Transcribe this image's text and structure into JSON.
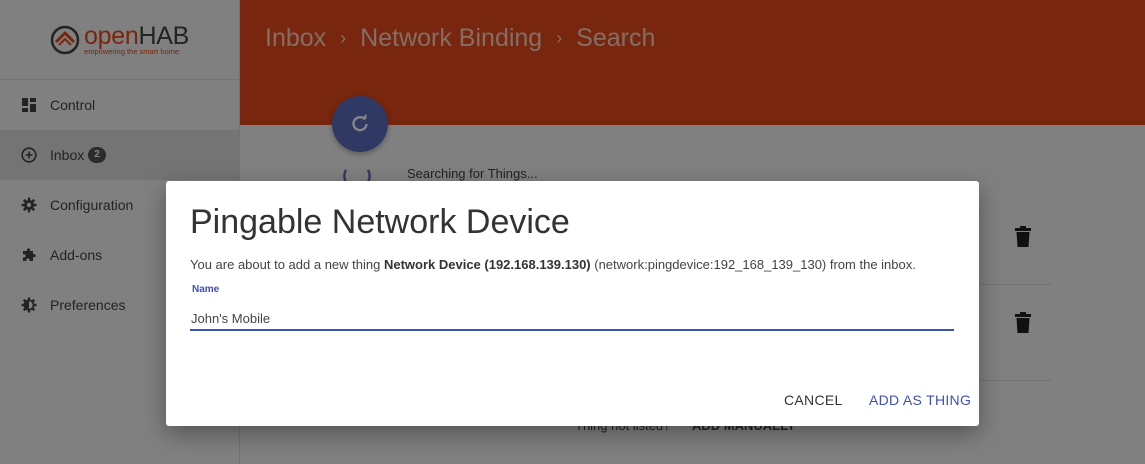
{
  "app": {
    "logo_open": "open",
    "logo_hab": "HAB",
    "logo_tagline": "empowering the smart home",
    "accent_color": "#e64a19",
    "primary_color": "#3f51b5"
  },
  "sidebar": {
    "items": [
      {
        "label": "Control",
        "icon": "dashboard-icon"
      },
      {
        "label": "Inbox",
        "icon": "add-circle-icon",
        "badge": "2",
        "active": true
      },
      {
        "label": "Configuration",
        "icon": "gear-icon"
      },
      {
        "label": "Add-ons",
        "icon": "puzzle-icon"
      },
      {
        "label": "Preferences",
        "icon": "contrast-icon"
      }
    ]
  },
  "header": {
    "breadcrumb": [
      "Inbox",
      "Network Binding",
      "Search"
    ],
    "separator": "›"
  },
  "main": {
    "refresh_icon": "refresh-icon",
    "searching_text": "Searching for Things...",
    "not_listed_text": "Thing not listed?",
    "add_manually_label": "ADD MANUALLY"
  },
  "dialog": {
    "title": "Pingable Network Device",
    "text_prefix": "You are about to add a new thing ",
    "thing_label": "Network Device (192.168.139.130)",
    "text_suffix": " (network:pingdevice:192_168_139_130) from the inbox.",
    "name_label": "Name",
    "name_value": "John's Mobile",
    "cancel_label": "CANCEL",
    "add_label": "ADD AS THING"
  }
}
